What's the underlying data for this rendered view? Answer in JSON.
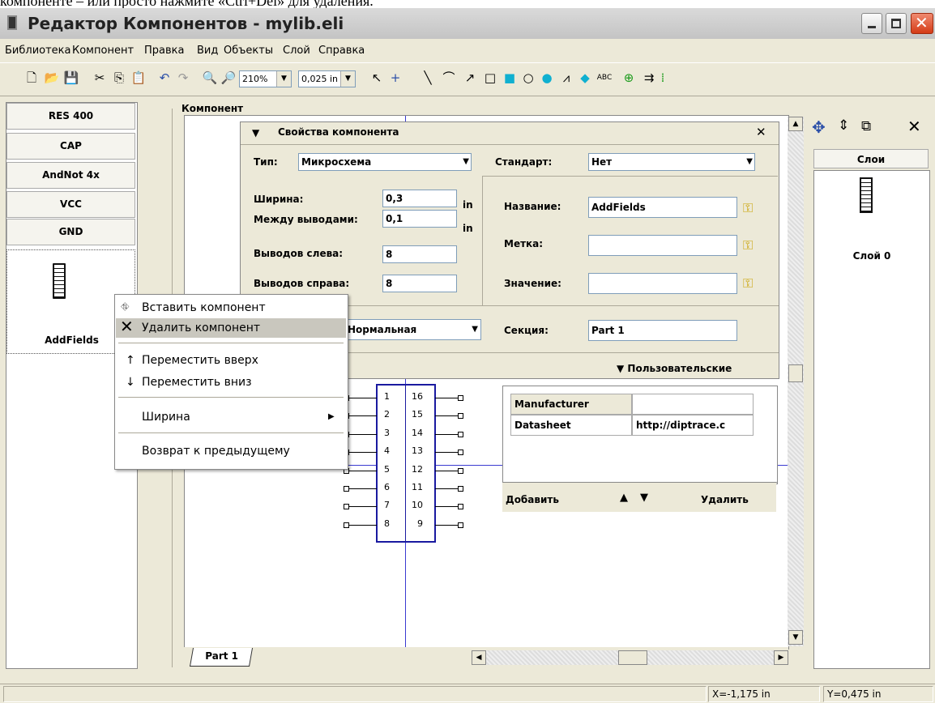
{
  "top_snippet": "компоненте – или просто нажмите «Ctrl+Del» для удаления.",
  "window": {
    "title": "Редактор Компонентов - mylib.eli"
  },
  "menu": [
    "Библиотека",
    "Компонент",
    "Правка",
    "Вид",
    "Объекты",
    "Слой",
    "Справка"
  ],
  "toolbar": {
    "zoom": "210%",
    "grid": "0,025 in"
  },
  "components": [
    "RES 400",
    "CAP",
    "AndNot 4x",
    "VCC",
    "GND"
  ],
  "selected_component": "AddFields",
  "workspace_label": "Компонент",
  "properties": {
    "title": "Свойства компонента",
    "type_label": "Тип:",
    "type_value": "Микросхема",
    "standard_label": "Стандарт:",
    "standard_value": "Нет",
    "width_label": "Ширина:",
    "width_value": "0,3",
    "width_unit": "in",
    "pitch_label": "Между выводами:",
    "pitch_value": "0,1",
    "pitch_unit": "in",
    "left_pins_label": "Выводов слева:",
    "left_pins_value": "8",
    "right_pins_label": "Выводов справа:",
    "right_pins_value": "8",
    "name_label": "Название:",
    "name_value": "AddFields",
    "mark_label": "Метка:",
    "mark_value": "",
    "value_label": "Значение:",
    "value_value": "",
    "mode_value": "Нормальная",
    "section_label": "Секция:",
    "section_value": "Part 1",
    "custom_label": "▼ Пользовательские"
  },
  "user_fields": {
    "rows": [
      {
        "name": "Manufacturer",
        "value": ""
      },
      {
        "name": "Datasheet",
        "value": "http://diptrace.c"
      }
    ],
    "add": "Добавить",
    "delete": "Удалить"
  },
  "pins_left": [
    "1",
    "2",
    "3",
    "4",
    "5",
    "6",
    "7",
    "8"
  ],
  "pins_right": [
    "16",
    "15",
    "14",
    "13",
    "12",
    "11",
    "10",
    "9"
  ],
  "context_menu": {
    "insert": "Вставить компонент",
    "delete": "Удалить компонент",
    "move_up": "Переместить вверх",
    "move_down": "Переместить вниз",
    "width": "Ширина",
    "revert": "Возврат к предыдущему"
  },
  "layers": {
    "title": "Слои",
    "layer0": "Слой 0"
  },
  "tab": "Part 1",
  "status": {
    "x": "X=-1,175 in",
    "y": "Y=0,475 in"
  }
}
